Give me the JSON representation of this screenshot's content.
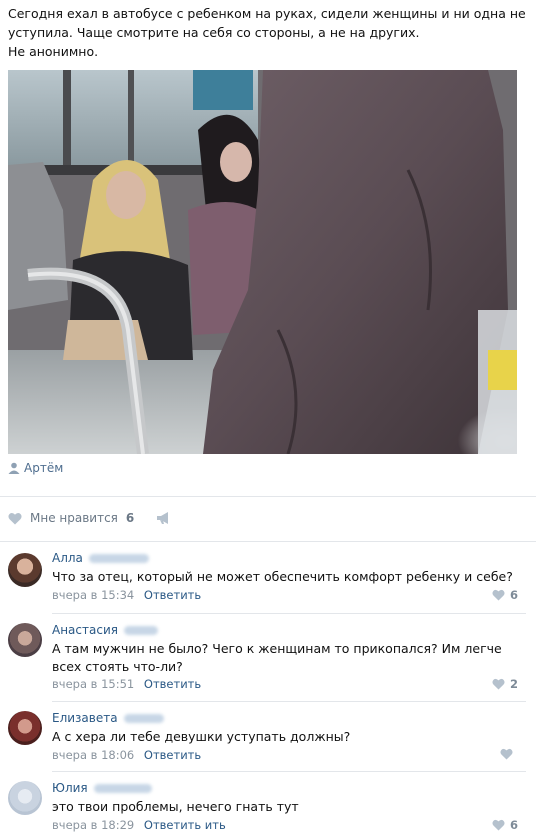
{
  "post": {
    "text_line1": "Сегодня ехал в автобусе с ребенком на руках, сидели женщины и ни одна не",
    "text_line2": "уступила. Чаще смотрите на себя со стороны, а не на других.",
    "text_line3": "Не анонимно.",
    "photo_icon": "bus-photo",
    "author": "Артём",
    "author_icon": "person-icon",
    "likes_label": "Мне нравится",
    "likes_count": "6",
    "share_icon": "megaphone-icon"
  },
  "colors": {
    "link": "#2a5885",
    "meta": "#8a949e",
    "separator": "#e3e6ea"
  },
  "comments": [
    {
      "name": "Алла",
      "text": "Что за отец, который не может обеспечить комфорт ребенку и себе?",
      "time": "вчера в 15:34",
      "reply": "Ответить",
      "likes": "6"
    },
    {
      "name": "Анастасия",
      "text": "А там мужчин не было? Чего к женщинам то прикопался? Им легче всех стоять что-ли?",
      "time": "вчера в 15:51",
      "reply": "Ответить",
      "likes": "2"
    },
    {
      "name": "Елизавета",
      "text": "А с хера ли тебе девушки уступать должны?",
      "time": "вчера в 18:06",
      "reply": "Ответить",
      "likes": ""
    },
    {
      "name": "Юлия",
      "text": "это твои проблемы, нечего гнать тут",
      "time": "вчера в 18:29",
      "reply": "Ответить ить",
      "likes": "6"
    }
  ]
}
